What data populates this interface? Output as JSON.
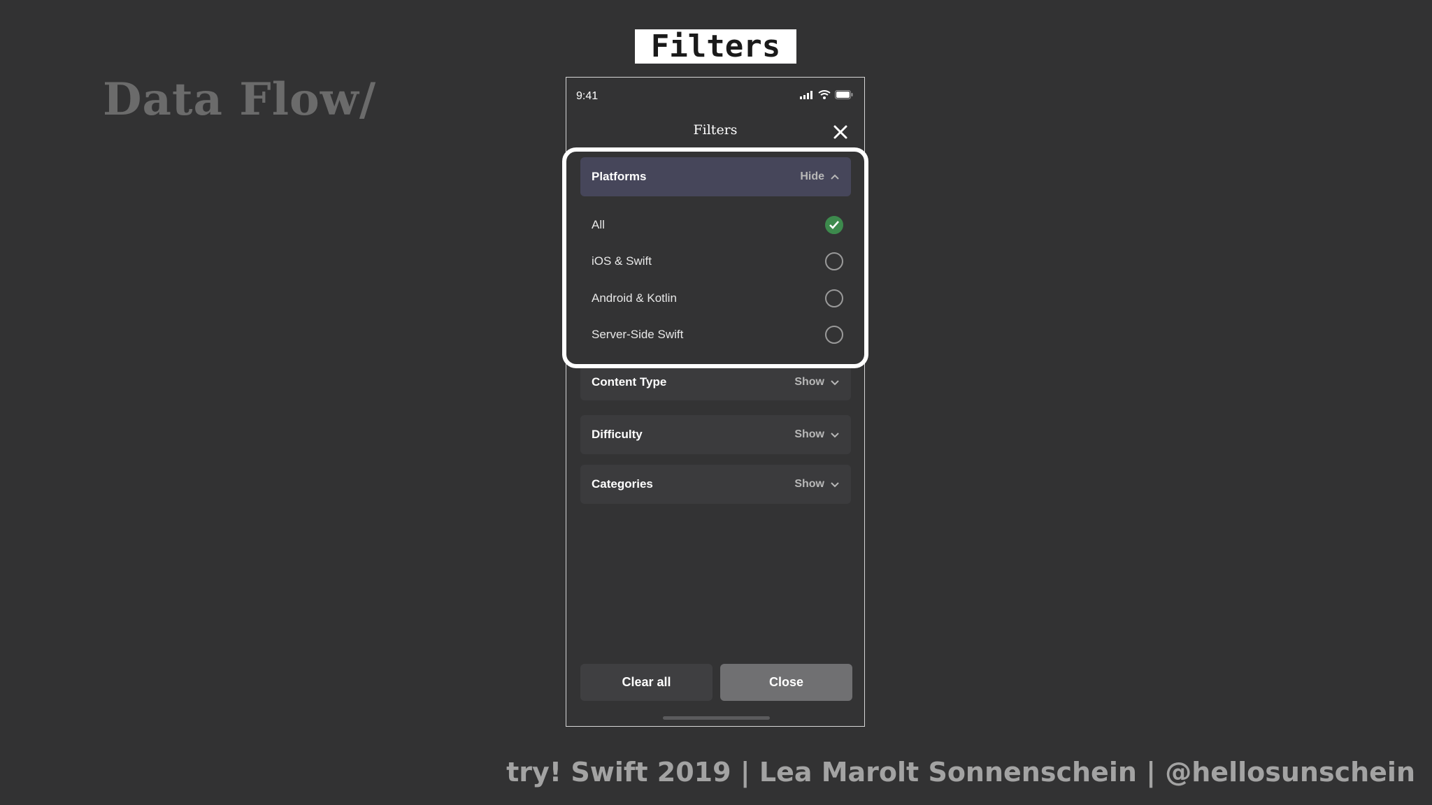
{
  "slide": {
    "title": "Data Flow/",
    "label": "Filters",
    "footer": "try! Swift 2019 | Lea Marolt Sonnenschein | @hellosunschein"
  },
  "status_bar": {
    "time": "9:41"
  },
  "nav": {
    "title": "Filters",
    "close_icon": "close-icon"
  },
  "sections": {
    "platforms": {
      "title": "Platforms",
      "toggle": "Hide"
    },
    "content_type": {
      "title": "Content Type",
      "toggle": "Show"
    },
    "difficulty": {
      "title": "Difficulty",
      "toggle": "Show"
    },
    "categories": {
      "title": "Categories",
      "toggle": "Show"
    }
  },
  "platform_options": [
    {
      "label": "All",
      "checked": true
    },
    {
      "label": "iOS & Swift",
      "checked": false
    },
    {
      "label": "Android & Kotlin",
      "checked": false
    },
    {
      "label": "Server-Side Swift",
      "checked": false
    }
  ],
  "buttons": {
    "clear": "Clear all",
    "close": "Close"
  },
  "colors": {
    "background": "#323233",
    "accent_check": "#3d8a4d",
    "open_section": "#46465a",
    "highlight_border": "#ffffff"
  }
}
